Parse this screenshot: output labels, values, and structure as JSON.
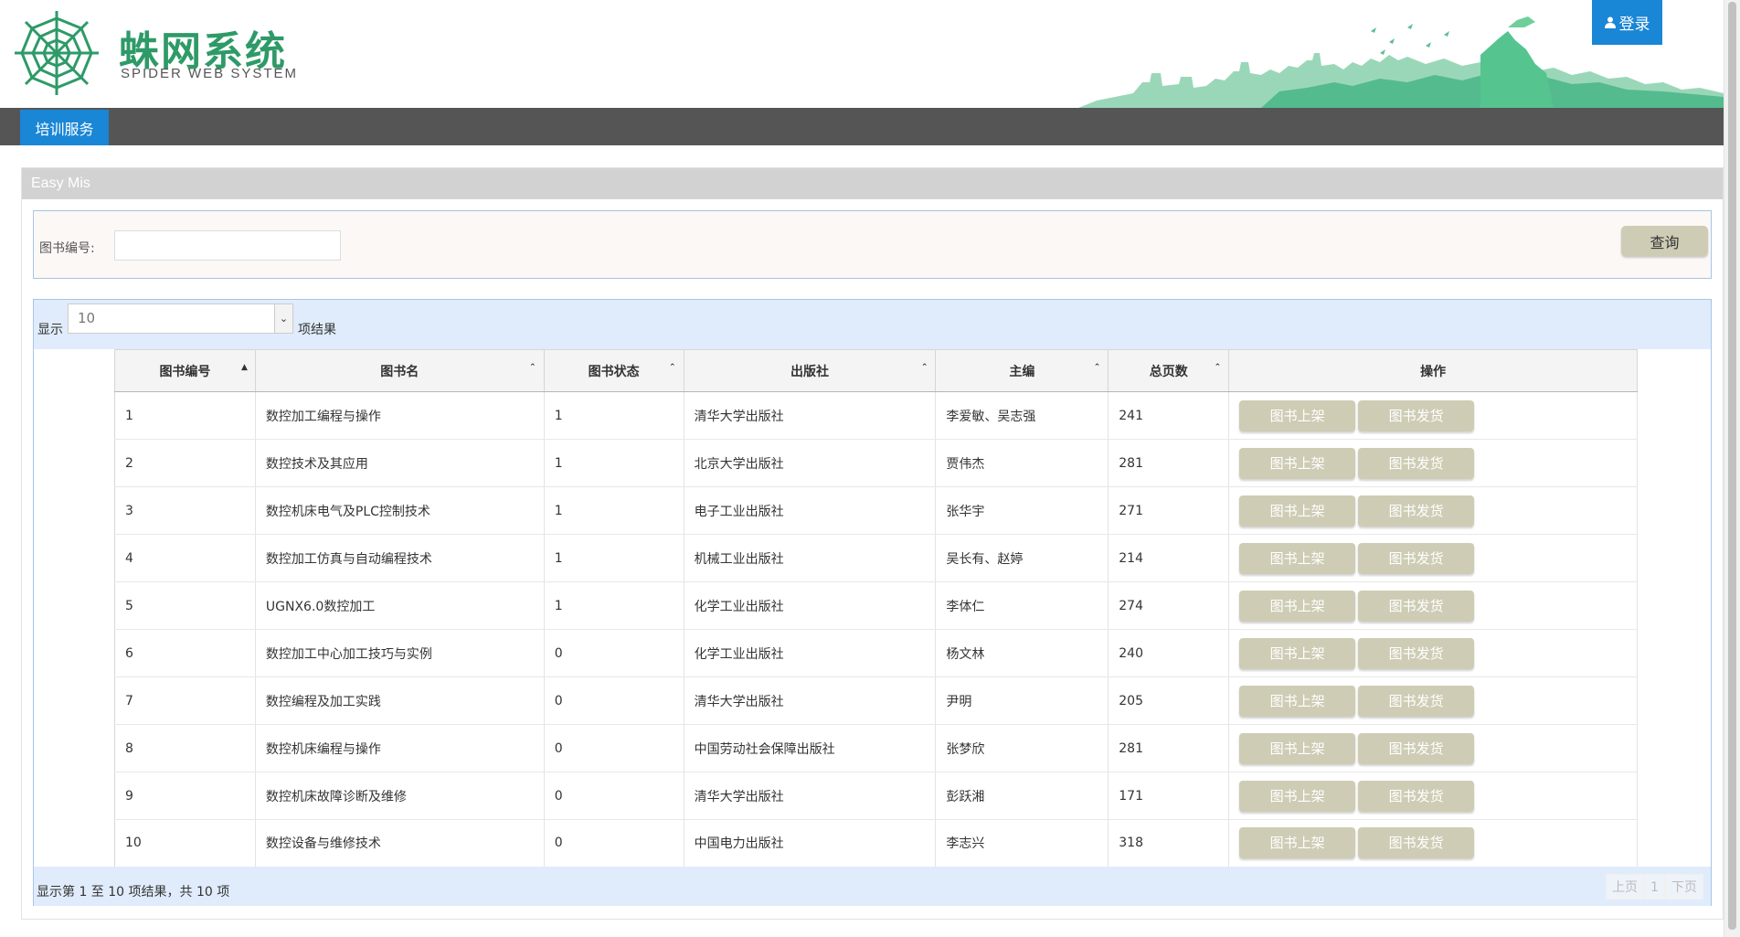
{
  "header": {
    "brand_cn": "蛛网系统",
    "brand_en": "SPIDER WEB SYSTEM",
    "login_label": "登录"
  },
  "nav": {
    "items": [
      {
        "label": "培训服务"
      }
    ]
  },
  "panel": {
    "title": "Easy Mis"
  },
  "search": {
    "label": "图书编号:",
    "value": "",
    "button": "查询"
  },
  "length": {
    "prefix": "显示",
    "value": "10",
    "suffix": "项结果"
  },
  "table": {
    "columns": [
      "图书编号",
      "图书名",
      "图书状态",
      "出版社",
      "主编",
      "总页数",
      "操作"
    ],
    "action_labels": [
      "图书上架",
      "图书发货"
    ],
    "rows": [
      [
        "1",
        "数控加工编程与操作",
        "1",
        "清华大学出版社",
        "李爱敏、吴志强",
        "241"
      ],
      [
        "2",
        "数控技术及其应用",
        "1",
        "北京大学出版社",
        "贾伟杰",
        "281"
      ],
      [
        "3",
        "数控机床电气及PLC控制技术",
        "1",
        "电子工业出版社",
        "张华宇",
        "271"
      ],
      [
        "4",
        "数控加工仿真与自动编程技术",
        "1",
        "机械工业出版社",
        "吴长有、赵婷",
        "214"
      ],
      [
        "5",
        "UGNX6.0数控加工",
        "1",
        "化学工业出版社",
        "李体仁",
        "274"
      ],
      [
        "6",
        "数控加工中心加工技巧与实例",
        "0",
        "化学工业出版社",
        "杨文林",
        "240"
      ],
      [
        "7",
        "数控编程及加工实践",
        "0",
        "清华大学出版社",
        "尹明",
        "205"
      ],
      [
        "8",
        "数控机床编程与操作",
        "0",
        "中国劳动社会保障出版社",
        "张梦欣",
        "281"
      ],
      [
        "9",
        "数控机床故障诊断及维修",
        "0",
        "清华大学出版社",
        "彭跃湘",
        "171"
      ],
      [
        "10",
        "数控设备与维修技术",
        "0",
        "中国电力出版社",
        "李志兴",
        "318"
      ]
    ]
  },
  "footer": {
    "info": "显示第 1 至 10 项结果，共 10 项",
    "prev": "上页",
    "page": "1",
    "next": "下页"
  },
  "colors": {
    "accent": "#1a86d6",
    "brand_green": "#2e9a68",
    "nav_bg": "#555555",
    "button_bg": "#cfccb5"
  }
}
